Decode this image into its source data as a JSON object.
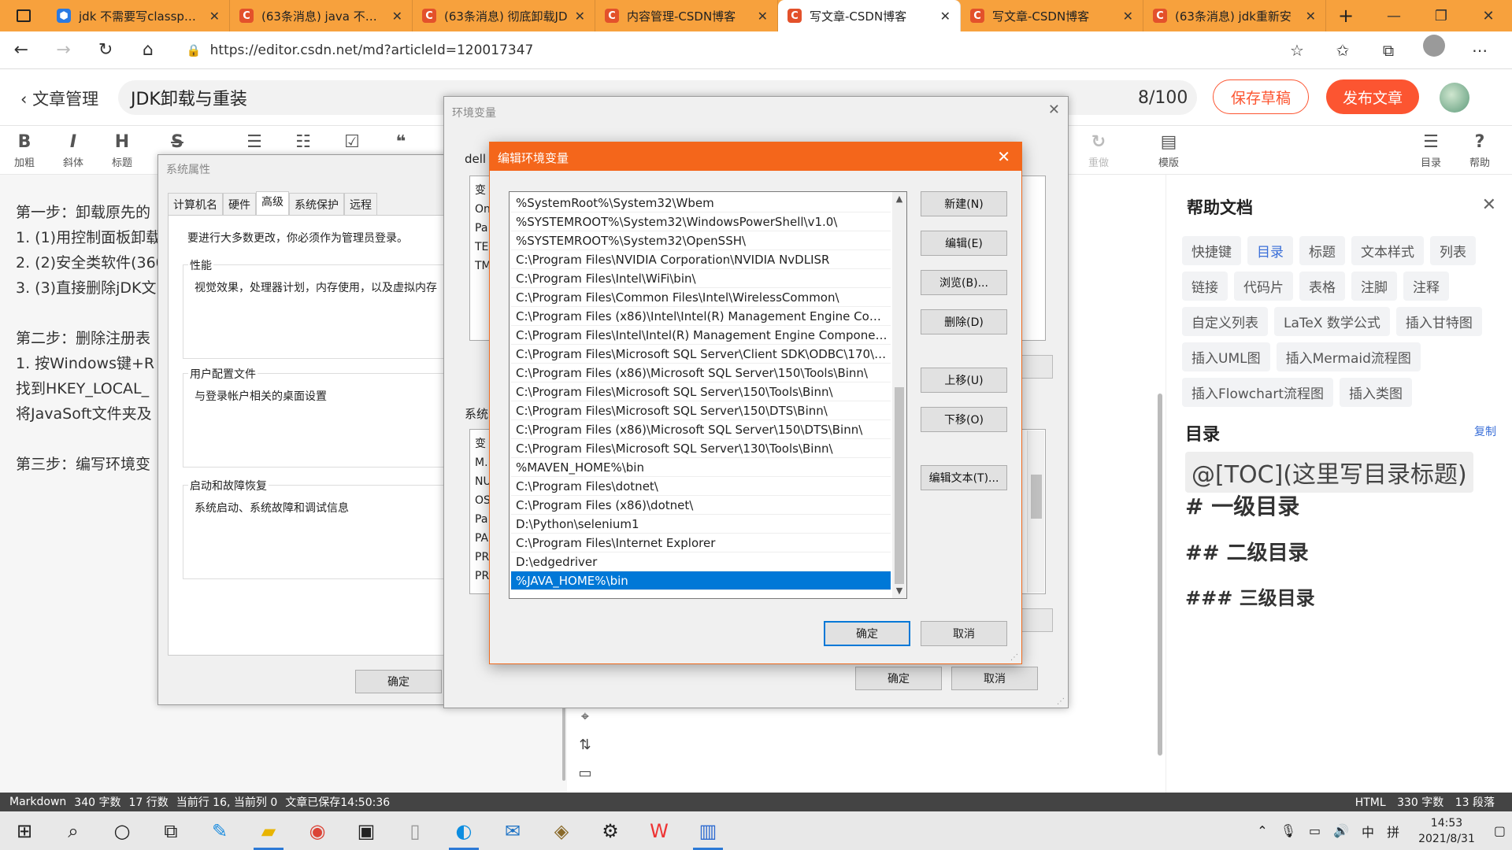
{
  "browser": {
    "tabs": [
      {
        "label": "jdk 不需要写classpath",
        "icon": "blue"
      },
      {
        "label": "(63条消息) java 不设置",
        "icon": "csdn"
      },
      {
        "label": "(63条消息) 彻底卸载JD",
        "icon": "csdn"
      },
      {
        "label": "内容管理-CSDN博客",
        "icon": "csdn"
      },
      {
        "label": "写文章-CSDN博客",
        "icon": "csdn",
        "active": true
      },
      {
        "label": "写文章-CSDN博客",
        "icon": "csdn"
      },
      {
        "label": "(63条消息) jdk重新安",
        "icon": "csdn"
      }
    ],
    "favicon_letter": "C",
    "url": "https://editor.csdn.net/md?articleId=120017347",
    "accent": "#f7a13d"
  },
  "editor_header": {
    "back_label": "文章管理",
    "title": "JDK卸载与重装",
    "title_count": "8/100",
    "save_draft": "保存草稿",
    "publish": "发布文章",
    "accent": "#fc5531"
  },
  "toolbar": {
    "bold": {
      "icon": "B",
      "label": "加粗"
    },
    "italic": {
      "icon": "I",
      "label": "斜体"
    },
    "heading": {
      "icon": "H",
      "label": "标题"
    },
    "strike": {
      "icon": "S",
      "label": ""
    },
    "redo": {
      "label": "重做"
    },
    "template": {
      "label": "模版"
    },
    "toc": {
      "label": "目录"
    },
    "help": {
      "label": "帮助"
    }
  },
  "editor_body": {
    "lines": [
      "第一步：卸载原先的",
      "1. (1)用控制面板卸载",
      "2. (2)安全类软件(360",
      "3. (3)直接删除jDK文",
      "",
      "第二步：删除注册表",
      "1. 按Windows键+R",
      "找到HKEY_LOCAL_",
      "将JavaSoft文件夹及",
      "",
      "第三步：编写环境变"
    ]
  },
  "help_panel": {
    "title": "帮助文档",
    "chips": [
      "快捷键",
      "目录",
      "标题",
      "文本样式",
      "列表",
      "链接",
      "代码片",
      "表格",
      "注脚",
      "注释",
      "自定义列表",
      "LaTeX 数学公式",
      "插入甘特图",
      "插入UML图",
      "插入Mermaid流程图",
      "插入Flowchart流程图",
      "插入类图"
    ],
    "active_chip": "目录",
    "toc_label": "目录",
    "copy_label": "复制",
    "toc_code": "@[TOC](这里写目录标题)",
    "h1": "# 一级目录",
    "h2": "## 二级目录",
    "h3": "### 三级目录"
  },
  "statusbar": {
    "mode": "Markdown",
    "words": "340 字数",
    "lines": "17 行数",
    "cursor": "当前行 16, 当前列 0",
    "saved": "文章已保存14:50:36",
    "right_mode": "HTML",
    "right_words": "330 字数",
    "right_paragraphs": "13 段落"
  },
  "system_properties": {
    "title": "系统属性",
    "tabs": [
      "计算机名",
      "硬件",
      "高级",
      "系统保护",
      "远程"
    ],
    "active_tab": "高级",
    "admin_note": "要进行大多数更改，你必须作为管理员登录。",
    "groups": [
      {
        "label": "性能",
        "desc": "视觉效果，处理器计划，内存使用，以及虚拟内存"
      },
      {
        "label": "用户配置文件",
        "desc": "与登录帐户相关的桌面设置"
      },
      {
        "label": "启动和故障恢复",
        "desc": "系统启动、系统故障和调试信息"
      }
    ],
    "ok": "确定"
  },
  "environment_variables": {
    "title": "环境变量",
    "user_label": "dell",
    "user_rows": [
      "变",
      "On",
      "Pa",
      "TE",
      "TM"
    ],
    "system_label": "系统",
    "system_rows": [
      "变",
      "M.",
      "NU",
      "OS",
      "Pa",
      "PA",
      "PR",
      "PR",
      "PR"
    ],
    "ok": "确定",
    "cancel": "取消"
  },
  "edit_env": {
    "title": "编辑环境变量",
    "paths": [
      "%SystemRoot%\\System32\\Wbem",
      "%SYSTEMROOT%\\System32\\WindowsPowerShell\\v1.0\\",
      "%SYSTEMROOT%\\System32\\OpenSSH\\",
      "C:\\Program Files\\NVIDIA Corporation\\NVIDIA NvDLISR",
      "C:\\Program Files\\Intel\\WiFi\\bin\\",
      "C:\\Program Files\\Common Files\\Intel\\WirelessCommon\\",
      "C:\\Program Files (x86)\\Intel\\Intel(R) Management Engine Comp...",
      "C:\\Program Files\\Intel\\Intel(R) Management Engine Componen...",
      "C:\\Program Files\\Microsoft SQL Server\\Client SDK\\ODBC\\170\\T...",
      "C:\\Program Files (x86)\\Microsoft SQL Server\\150\\Tools\\Binn\\",
      "C:\\Program Files\\Microsoft SQL Server\\150\\Tools\\Binn\\",
      "C:\\Program Files\\Microsoft SQL Server\\150\\DTS\\Binn\\",
      "C:\\Program Files (x86)\\Microsoft SQL Server\\150\\DTS\\Binn\\",
      "C:\\Program Files\\Microsoft SQL Server\\130\\Tools\\Binn\\",
      "%MAVEN_HOME%\\bin",
      "C:\\Program Files\\dotnet\\",
      "C:\\Program Files (x86)\\dotnet\\",
      "D:\\Python\\selenium1",
      "C:\\Program Files\\Internet Explorer",
      "D:\\edgedriver",
      "%JAVA_HOME%\\bin"
    ],
    "selected_index": 20,
    "buttons": {
      "new": "新建(N)",
      "edit": "编辑(E)",
      "browse": "浏览(B)...",
      "delete": "删除(D)",
      "up": "上移(U)",
      "down": "下移(O)",
      "edit_text": "编辑文本(T)..."
    },
    "ok": "确定",
    "cancel": "取消",
    "accent": "#f4661b"
  },
  "taskbar": {
    "time": "14:53",
    "date": "2021/8/31",
    "ime": "中",
    "ime2": "拼"
  }
}
